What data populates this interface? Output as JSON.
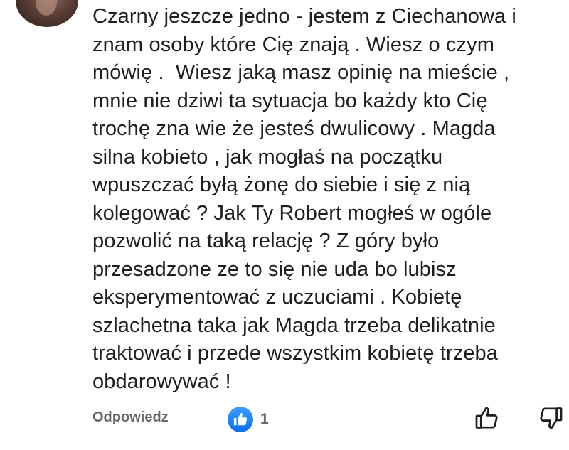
{
  "comment": {
    "lines": [
      "Czarny jeszcze jedno - jestem z Ciechanowa i",
      "znam osoby które Cię znają . Wiesz o czym",
      "mówię .  Wiesz jaką masz opinię na mieście ,",
      "mnie nie dziwi ta sytuacja bo każdy kto Cię",
      "trochę zna wie że jesteś dwulicowy . Magda",
      "silna kobieto , jak mogłaś na początku",
      "wpuszczać byłą żonę do siebie i się z nią",
      "kolegować ? Jak Ty Robert mogłeś w ogóle",
      "pozwolić na taką relację ? Z góry było",
      "przesadzone ze to się nie uda bo lubisz",
      "eksperymentować z uczuciami . Kobietę",
      "szlachetna taka jak Magda trzeba delikatnie",
      "traktować i przede wszystkim kobietę trzeba",
      "obdarowywać !"
    ]
  },
  "actions": {
    "reply_label": "Odpowiedz",
    "like_count": "1"
  },
  "icons": {
    "like_badge": "thumbs-up-filled",
    "like_button": "thumbs-up-outline",
    "dislike_button": "thumbs-down-outline"
  },
  "colors": {
    "text": "#1c1e21",
    "secondary": "#65676b",
    "like_blue": "#0a6cf2"
  }
}
